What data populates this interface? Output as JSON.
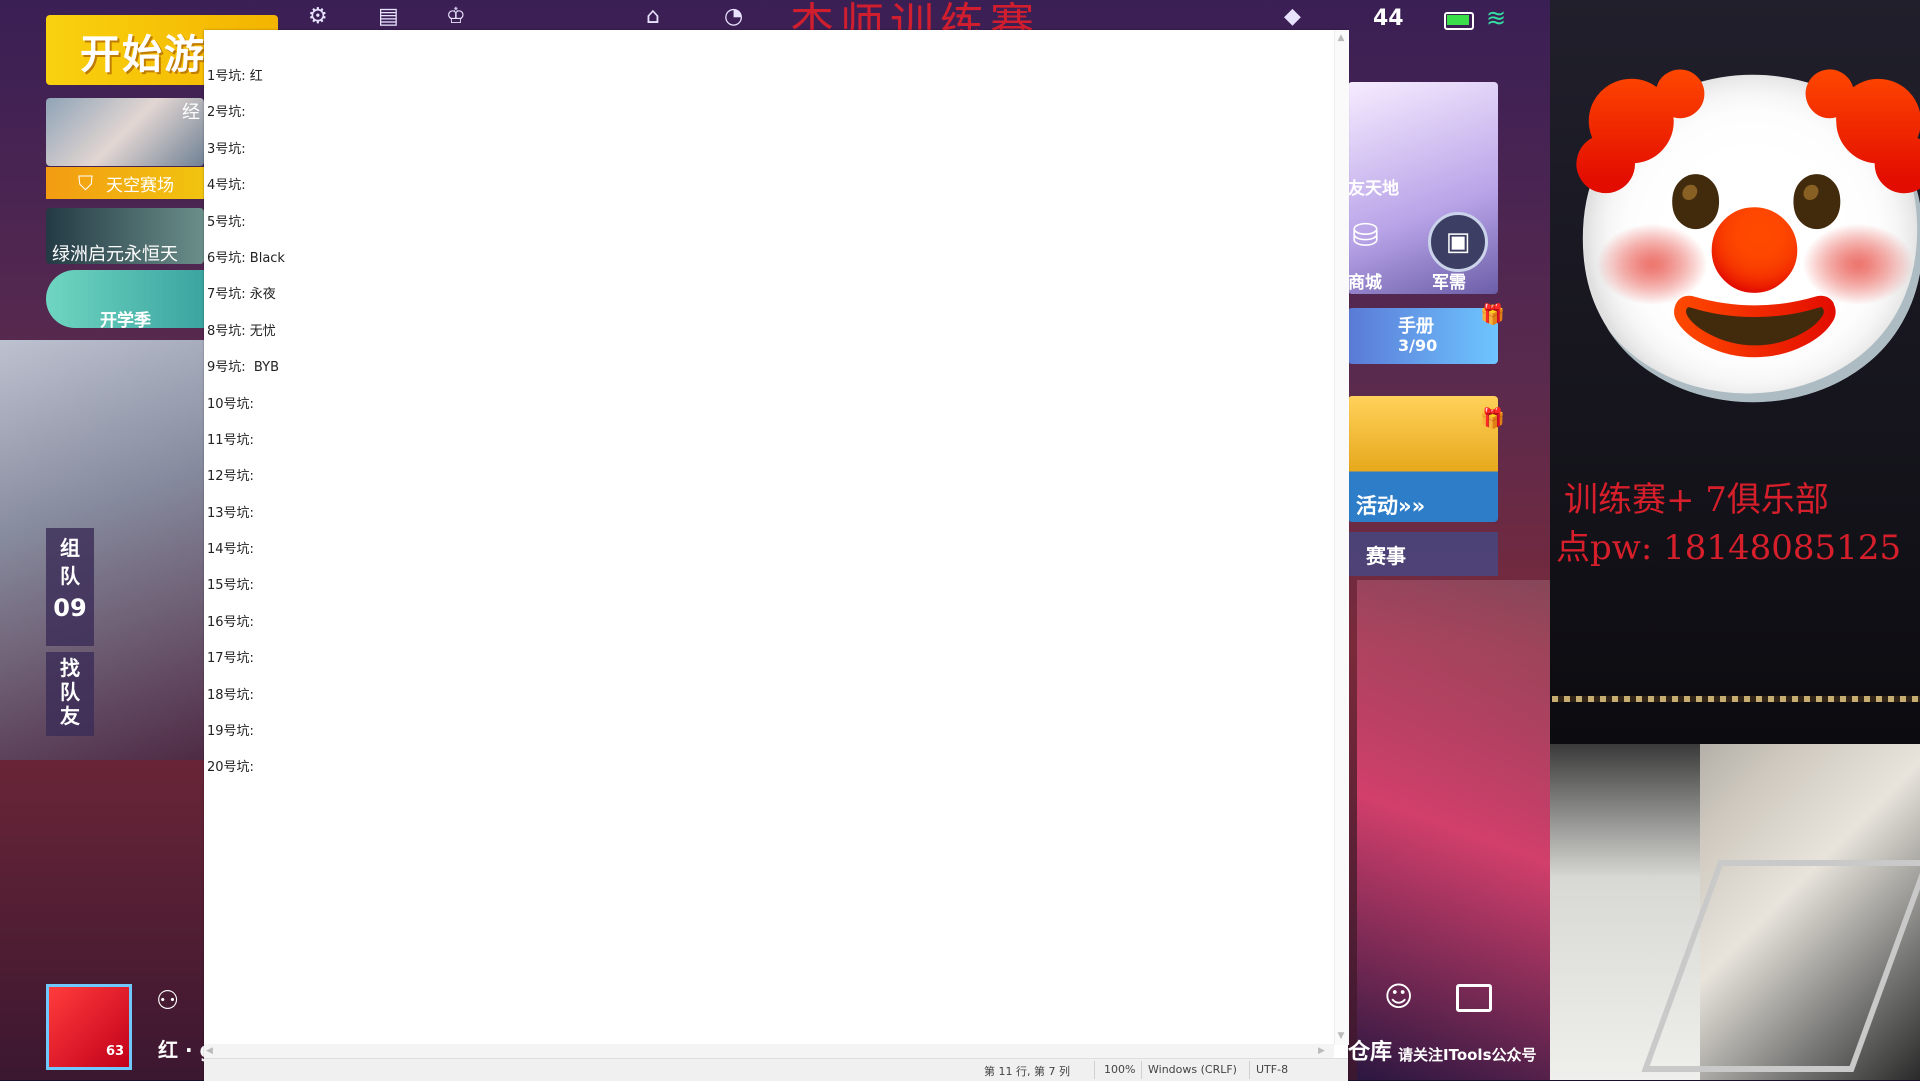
{
  "game": {
    "title_overlay": "杰师训练赛",
    "status": {
      "time": "44"
    },
    "start_button": "开始游",
    "mode_card": "经",
    "sky_card": "天空赛场",
    "oasis_card": "绿洲启元永恒天",
    "school_card": "开学季",
    "team": {
      "label": "组队",
      "count": "09"
    },
    "find_team": "找队友",
    "player": {
      "level": "63",
      "name": "红 · g"
    },
    "hero_label": "友天地",
    "shop_label": "商城",
    "military_label": "军需",
    "handbook": {
      "label": "手册",
      "progress": "3/90"
    },
    "activity_label": "活动»»",
    "event_label": "赛事",
    "warehouse_label": "仓库",
    "follow_label": "请关注ITools公众号",
    "icons": [
      "store-icon",
      "chart-icon",
      "trophy-icon",
      "home-icon",
      "clock-icon",
      "gem-icon",
      "battery-icon",
      "wifi-icon",
      "shield-icon",
      "friends-icon",
      "emoji-icon",
      "fullscreen-icon",
      "gift-icon"
    ]
  },
  "overlay": {
    "line1": "训练赛+  7俱乐部",
    "line2": "点pw: 18148085125"
  },
  "notepad": {
    "lines": [
      "1号坑: 红",
      "2号坑:",
      "3号坑:",
      "4号坑:",
      "5号坑:",
      "6号坑: Black",
      "7号坑: 永夜",
      "8号坑: 无忧",
      "9号坑:  BYB",
      "10号坑:",
      "11号坑:",
      "12号坑:",
      "13号坑:",
      "14号坑:",
      "15号坑:",
      "16号坑:",
      "17号坑:",
      "18号坑:",
      "19号坑:",
      "20号坑:"
    ],
    "status": {
      "position": "第 11 行, 第 7 列",
      "zoom": "100%",
      "line_ending": "Windows (CRLF)",
      "encoding": "UTF-8"
    }
  }
}
